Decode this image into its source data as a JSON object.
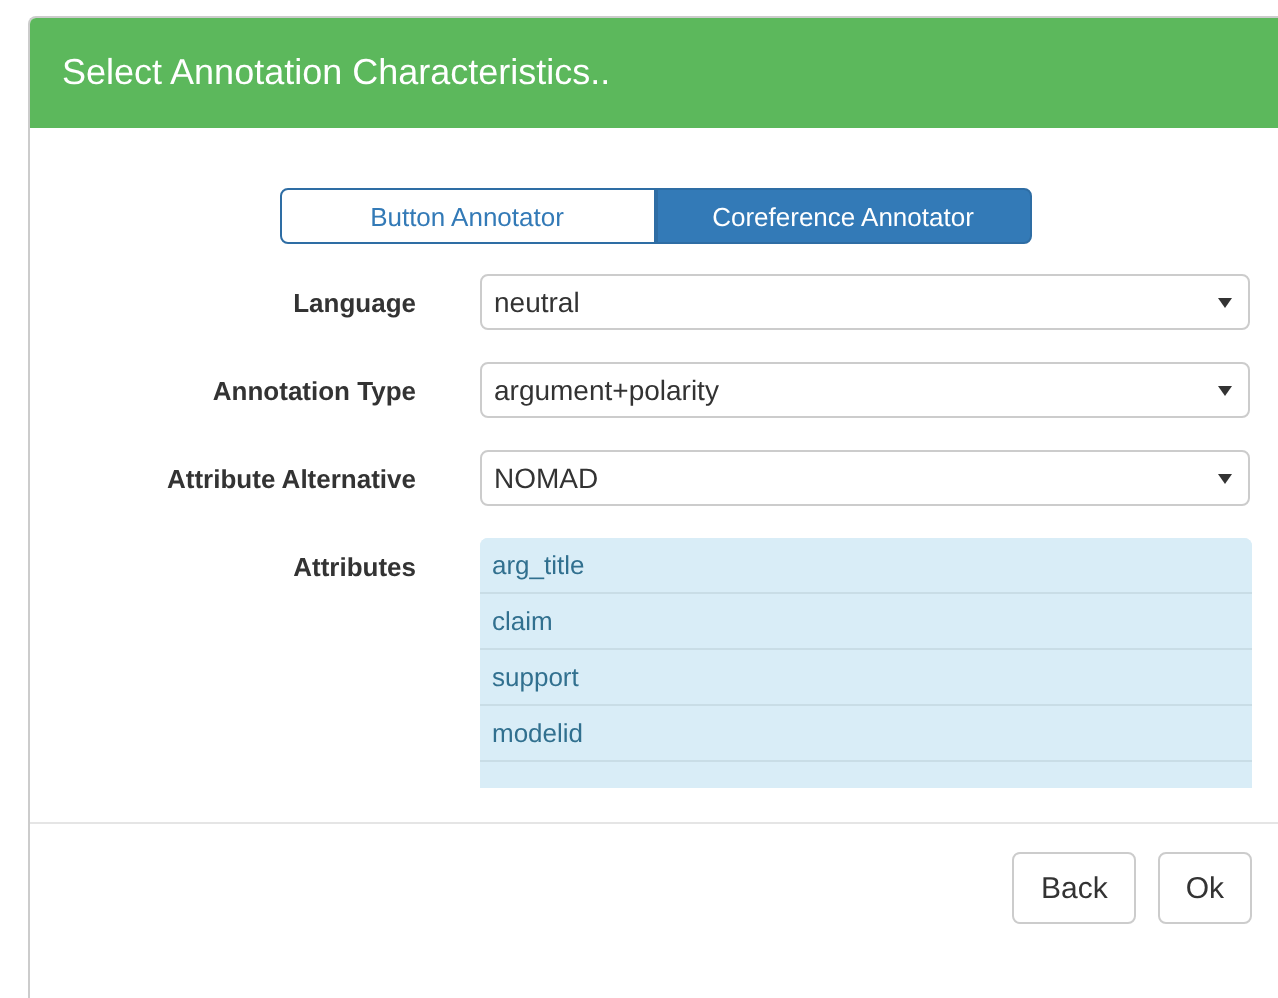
{
  "dialog": {
    "title": "Select Annotation Characteristics.."
  },
  "tabs": [
    {
      "label": "Button Annotator",
      "selected": false
    },
    {
      "label": "Coreference Annotator",
      "selected": true
    }
  ],
  "fields": [
    {
      "label": "Language",
      "value": "neutral"
    },
    {
      "label": "Annotation Type",
      "value": "argument+polarity"
    },
    {
      "label": "Attribute Alternative",
      "value": "NOMAD"
    }
  ],
  "attributes": {
    "label": "Attributes",
    "items": [
      {
        "label": "arg_title",
        "selected": true
      },
      {
        "label": "claim",
        "selected": true
      },
      {
        "label": "support",
        "selected": true
      },
      {
        "label": "modelid",
        "selected": true
      }
    ]
  },
  "buttons": [
    "Back",
    "Ok"
  ]
}
